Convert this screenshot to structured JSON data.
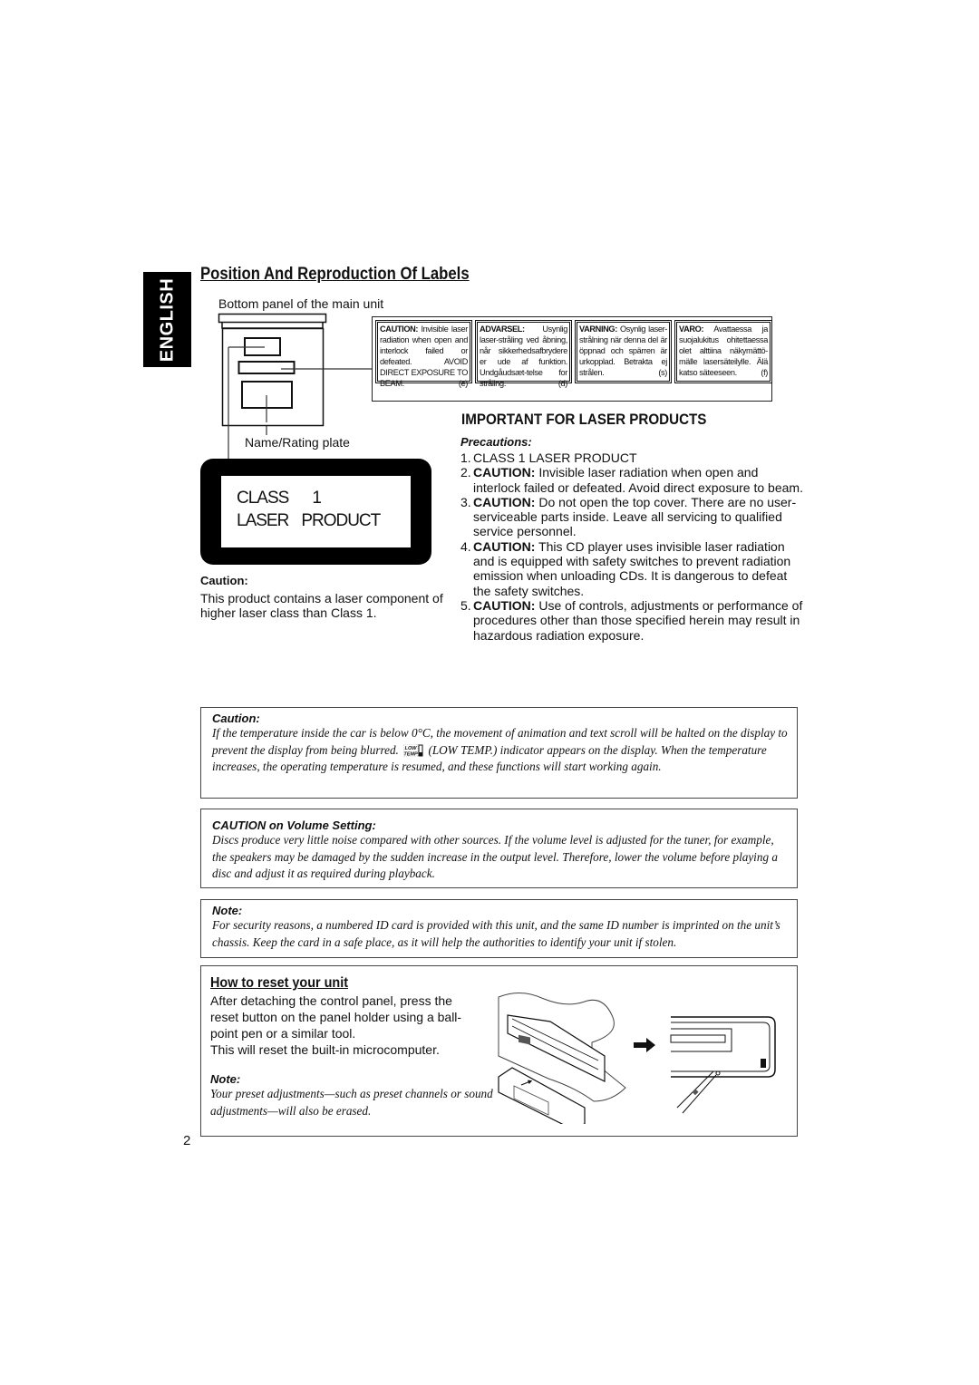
{
  "sidebar_tab": {
    "label": "ENGLISH"
  },
  "section_labels": {
    "title": "Position And Reproduction Of Labels",
    "bottom_panel_caption": "Bottom panel of the main unit",
    "name_plate_caption": "Name/Rating plate",
    "warning_labels": [
      {
        "lead": "CAUTION:",
        "text": "Invisible laser radiation when open and interlock failed or defeated. AVOID DIRECT EXPOSURE TO BEAM.",
        "ref": "(e)"
      },
      {
        "lead": "ADVARSEL:",
        "text": "Usynlig laser-stråling ved åbning, når sikkerhedsafbrydere er ude af funktion. Undgåudsæt-telse for stråling.",
        "ref": "(d)"
      },
      {
        "lead": "VARNING:",
        "text": "Osynlig laser-strålning när denna del är öppnad och spärren är urkopplad. Betrakta ej strålen.",
        "ref": "(s)"
      },
      {
        "lead": "VARO:",
        "text": "Avattaessa ja suojalukitus ohitettaessa olet alttiina näkymättö-mälle lasersäteilylle. Älä katso säteeseen.",
        "ref": "(f)"
      }
    ],
    "plate": {
      "line1_a": "CLASS",
      "line1_b": "1",
      "line2_a": "LASER",
      "line2_b": "PRODUCT"
    },
    "caution_heading": "Caution:",
    "caution_text": "This product contains a laser component of higher laser class than Class 1."
  },
  "laser_products": {
    "title": "IMPORTANT FOR LASER PRODUCTS",
    "subtitle": "Precautions:",
    "items": [
      {
        "num": "1.",
        "lead": "",
        "text": "CLASS 1 LASER PRODUCT"
      },
      {
        "num": "2.",
        "lead": "CAUTION:",
        "text": " Invisible laser radiation when open and interlock failed or defeated. Avoid direct exposure to beam."
      },
      {
        "num": "3.",
        "lead": "CAUTION:",
        "text": " Do not open the top cover. There are no user-serviceable parts inside. Leave all servicing to qualified service personnel."
      },
      {
        "num": "4.",
        "lead": "CAUTION:",
        "text": " This CD player uses invisible laser radiation and is equipped with safety switches to prevent radiation emission when unloading CDs. It is dangerous to defeat the safety switches."
      },
      {
        "num": "5.",
        "lead": "CAUTION:",
        "text": " Use of controls, adjustments or performance of procedures other than those specified herein may result in hazardous radiation exposure."
      }
    ]
  },
  "temp_caution": {
    "heading": "Caution:",
    "text_before_icon": "If the temperature inside the car is below 0°C, the movement of animation and text scroll will be halted on the display to prevent the display from being blurred.",
    "icon_label": "LOW TEMP",
    "text_after_icon": "(LOW TEMP.) indicator appears on the display. When the temperature increases, the operating temperature is resumed, and these functions will start working again."
  },
  "volume_caution": {
    "heading": "CAUTION on Volume Setting:",
    "text": "Discs produce very little noise compared with other sources. If the volume level is adjusted for the tuner, for example, the speakers may be damaged by the sudden increase in the output level. Therefore, lower the volume before playing a disc and adjust it as required during playback."
  },
  "id_note": {
    "heading": "Note:",
    "text": "For security reasons, a numbered ID card is provided with this unit, and the same ID number is imprinted on the unit’s chassis. Keep the card in a safe place, as it will help the authorities to identify your unit if stolen."
  },
  "reset": {
    "title": "How to reset your unit",
    "text": "After detaching the control panel, press the reset button on the panel holder using a ball-point pen or a similar tool.",
    "text2": "This will reset the built-in microcomputer.",
    "note_heading": "Note:",
    "note_text": "Your preset adjustments—such as preset channels or sound adjustments—will also be erased."
  },
  "page_number": "2"
}
